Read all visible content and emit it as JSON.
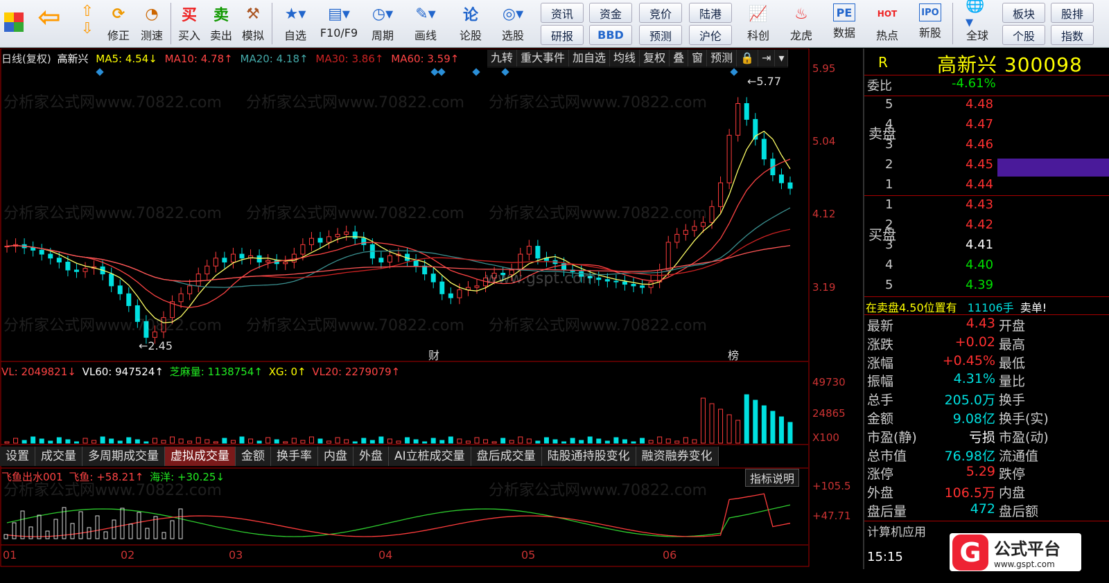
{
  "toolbar": {
    "buttons": [
      {
        "label": "修正",
        "icon": "correct-icon"
      },
      {
        "label": "测速",
        "icon": "speed-test-icon"
      },
      {
        "label": "买入",
        "glyph": "买"
      },
      {
        "label": "卖出",
        "glyph": "卖"
      },
      {
        "label": "模拟",
        "icon": "hammer-icon"
      },
      {
        "label": "自选",
        "icon": "star-icon"
      },
      {
        "label": "F10/F9",
        "icon": "f10-icon"
      },
      {
        "label": "周期",
        "icon": "period-icon"
      },
      {
        "label": "画线",
        "icon": "pencil-icon"
      },
      {
        "label": "论股",
        "glyph": "论"
      },
      {
        "label": "选股",
        "icon": "select-stock-icon"
      },
      {
        "label": "科创",
        "icon": "kechuang-icon"
      },
      {
        "label": "龙虎",
        "icon": "dragon-icon"
      },
      {
        "label": "数据",
        "glyph": "PE"
      },
      {
        "label": "热点",
        "glyph": "HOT"
      },
      {
        "label": "新股",
        "glyph": "IPO"
      },
      {
        "label": "全球",
        "icon": "globe-icon"
      }
    ],
    "pairs": [
      {
        "top": "资讯",
        "bottom": "研报"
      },
      {
        "top": "资金",
        "bottom": "BBD"
      },
      {
        "top": "竞价",
        "bottom": "预测"
      },
      {
        "top": "陆港",
        "bottom": "沪伦"
      },
      {
        "top": "板块",
        "bottom": "个股"
      },
      {
        "top": "股排",
        "bottom": "指数"
      }
    ]
  },
  "chart_header": {
    "period": "日线(复权)",
    "stock_name": "高新兴",
    "ma5": "MA5: 4.54↓",
    "ma10": "MA10: 4.78↑",
    "ma20": "MA20: 4.18↑",
    "ma30": "MA30: 3.86↑",
    "ma60": "MA60: 3.59↑"
  },
  "chart_buttons": [
    "九转",
    "重大事件",
    "加自选",
    "均线",
    "复权",
    "叠",
    "窗",
    "预测",
    "🔒",
    "⇥",
    "▾"
  ],
  "price_axis": [
    "5.95",
    "5.04",
    "4.12",
    "3.19"
  ],
  "annotations": {
    "high": "5.77",
    "low": "2.45",
    "finance_marker": "财",
    "rank_marker": "榜"
  },
  "watermarks": [
    "分析家公式网www.70822.com",
    "www.gspt.com"
  ],
  "volume_header": {
    "vl": "VL: 2049821↓",
    "vl60": "VL60: 947524↑",
    "zhima": "芝麻量: 1138754↑",
    "xg": "XG: 0↑",
    "vl20": "VL20: 2279079↑"
  },
  "volume_axis": [
    "49730",
    "24865",
    "X100"
  ],
  "tabs": [
    "设置",
    "成交量",
    "多周期成交量",
    "虚拟成交量",
    "金额",
    "换手率",
    "内盘",
    "外盘",
    "AI立桩成交量",
    "盘后成交量",
    "陆股通持股变化",
    "融资融券变化"
  ],
  "active_tab": "虚拟成交量",
  "indicator_header": {
    "title": "飞鱼出水001",
    "fish": "飞鱼: +58.21↑",
    "ocean": "海洋: +30.25↓",
    "help": "指标说明"
  },
  "indicator_axis": [
    "+105.5",
    "+47.71"
  ],
  "months": [
    "01",
    "02",
    "03",
    "04",
    "05",
    "06"
  ],
  "right_panel": {
    "r_label": "R",
    "stock_title": "高新兴 300098",
    "weibi_label": "委比",
    "weibi_value": "-4.61%",
    "sell_label": "卖盘",
    "buy_label": "买盘",
    "sell_levels": [
      {
        "n": "5",
        "price": "4.48"
      },
      {
        "n": "4",
        "price": "4.47"
      },
      {
        "n": "3",
        "price": "4.46"
      },
      {
        "n": "2",
        "price": "4.45"
      },
      {
        "n": "1",
        "price": "4.44"
      }
    ],
    "buy_levels": [
      {
        "n": "1",
        "price": "4.43"
      },
      {
        "n": "2",
        "price": "4.42"
      },
      {
        "n": "3",
        "price": "4.41"
      },
      {
        "n": "4",
        "price": "4.40"
      },
      {
        "n": "5",
        "price": "4.39"
      }
    ],
    "big_order_text": "在卖盘4.50位置有",
    "big_order_qty": "11106手",
    "big_order_type": "卖单!",
    "stats": [
      {
        "l": "最新",
        "v": "4.43",
        "r": "开盘"
      },
      {
        "l": "涨跌",
        "v": "+0.02",
        "r": "最高"
      },
      {
        "l": "涨幅",
        "v": "+0.45%",
        "r": "最低"
      },
      {
        "l": "振幅",
        "v": "4.31%",
        "r": "量比"
      },
      {
        "l": "总手",
        "v": "205.0万",
        "r": "换手"
      },
      {
        "l": "金额",
        "v": "9.08亿",
        "r": "换手(实)"
      },
      {
        "l": "市盈(静)",
        "v": "亏损",
        "r": "市盈(动)"
      },
      {
        "l": "总市值",
        "v": "76.98亿",
        "r": "流通值"
      },
      {
        "l": "涨停",
        "v": "5.29",
        "r": "跌停"
      },
      {
        "l": "外盘",
        "v": "106.5万",
        "r": "内盘"
      },
      {
        "l": "盘后量",
        "v": "472",
        "r": "盘后额"
      }
    ],
    "calc_app": "计算机应用",
    "time": "15:15",
    "logo_text": "公式平台",
    "logo_url": "www.gspt.com"
  }
}
